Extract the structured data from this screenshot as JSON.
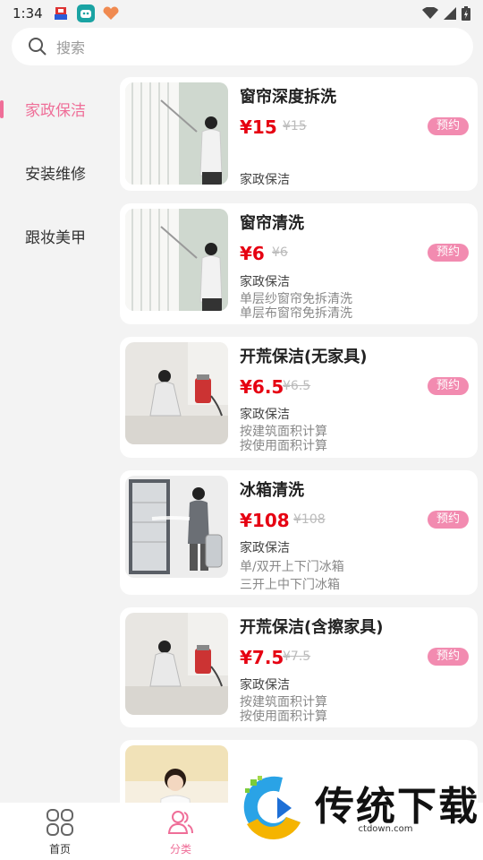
{
  "status": {
    "time": "1:34"
  },
  "search": {
    "placeholder": "搜索"
  },
  "sidebar": {
    "items": [
      {
        "label": "家政保洁",
        "active": true
      },
      {
        "label": "安装维修",
        "active": false
      },
      {
        "label": "跟妆美甲",
        "active": false
      }
    ]
  },
  "products": [
    {
      "title": "窗帘深度拆洗",
      "price": "¥15",
      "original_price": "¥15",
      "action": "预约",
      "category": "家政保洁",
      "desc": []
    },
    {
      "title": "窗帘清洗",
      "price": "¥6",
      "original_price": "¥6",
      "action": "预约",
      "category": "家政保洁",
      "desc": [
        "单层纱窗帘免拆清洗",
        "单层布窗帘免拆清洗"
      ]
    },
    {
      "title": "开荒保洁(无家具)",
      "price": "¥6.5",
      "original_price": "¥6.5",
      "action": "预约",
      "category": "家政保洁",
      "desc": [
        "按建筑面积计算",
        "按使用面积计算"
      ]
    },
    {
      "title": "冰箱清洗",
      "price": "¥108",
      "original_price": "¥108",
      "action": "预约",
      "category": "家政保洁",
      "desc": [
        "单/双开上下门冰箱",
        "三开上中下门冰箱"
      ]
    },
    {
      "title": "开荒保洁(含擦家具)",
      "price": "¥7.5",
      "original_price": "¥7.5",
      "action": "预约",
      "category": "家政保洁",
      "desc": [
        "按建筑面积计算",
        "按使用面积计算"
      ]
    },
    {
      "title": "",
      "price": "",
      "original_price": "",
      "action": "",
      "category": "",
      "desc": []
    }
  ],
  "nav": {
    "home": {
      "label": "首页"
    },
    "category": {
      "label": "分类"
    }
  },
  "watermark": {
    "title": "传统下载",
    "url": "ctdown.com"
  },
  "colors": {
    "accent": "#ef6e98",
    "price": "#e60012",
    "badge": "#f28bb0"
  }
}
